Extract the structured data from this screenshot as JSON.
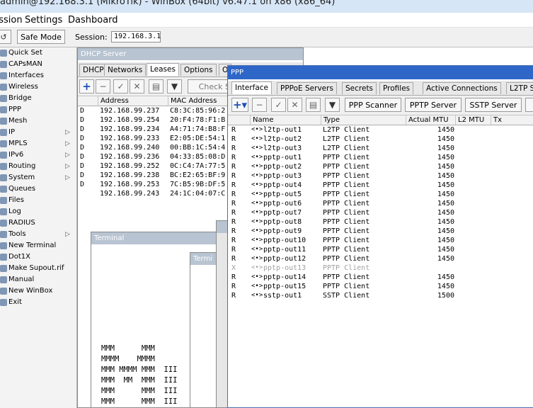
{
  "app": {
    "title": "admin@192.168.3.1 (MikroTik) - WinBox (64bit) v6.47.1 on x86 (x86_64)"
  },
  "menu": [
    "Session",
    "Settings",
    "Dashboard"
  ],
  "toolbar": {
    "safe_mode": "Safe Mode",
    "session_label": "Session:",
    "session_value": "192.168.3.1"
  },
  "sidebar": {
    "items": [
      {
        "label": "Quick Set",
        "arrow": ""
      },
      {
        "label": "CAPsMAN",
        "arrow": ""
      },
      {
        "label": "Interfaces",
        "arrow": ""
      },
      {
        "label": "Wireless",
        "arrow": ""
      },
      {
        "label": "Bridge",
        "arrow": ""
      },
      {
        "label": "PPP",
        "arrow": ""
      },
      {
        "label": "Mesh",
        "arrow": ""
      },
      {
        "label": "IP",
        "arrow": "▷"
      },
      {
        "label": "MPLS",
        "arrow": "▷"
      },
      {
        "label": "IPv6",
        "arrow": "▷"
      },
      {
        "label": "Routing",
        "arrow": "▷"
      },
      {
        "label": "System",
        "arrow": "▷"
      },
      {
        "label": "Queues",
        "arrow": ""
      },
      {
        "label": "Files",
        "arrow": ""
      },
      {
        "label": "Log",
        "arrow": ""
      },
      {
        "label": "RADIUS",
        "arrow": ""
      },
      {
        "label": "Tools",
        "arrow": "▷"
      },
      {
        "label": "New Terminal",
        "arrow": ""
      },
      {
        "label": "Dot1X",
        "arrow": ""
      },
      {
        "label": "Make Supout.rif",
        "arrow": ""
      },
      {
        "label": "Manual",
        "arrow": ""
      },
      {
        "label": "New WinBox",
        "arrow": ""
      },
      {
        "label": "Exit",
        "arrow": ""
      }
    ]
  },
  "dhcp": {
    "title": "DHCP Server",
    "tabs": [
      "DHCP",
      "Networks",
      "Leases",
      "Options",
      "O"
    ],
    "check_status": "Check St",
    "columns": [
      "Address",
      "MAC Address"
    ],
    "rows": [
      {
        "flag": "D",
        "address": "192.168.99.237",
        "mac": "C8:3C:85:96:2"
      },
      {
        "flag": "D",
        "address": "192.168.99.254",
        "mac": "20:F4:78:F1:B"
      },
      {
        "flag": "D",
        "address": "192.168.99.234",
        "mac": "A4:71:74:B8:F"
      },
      {
        "flag": "D",
        "address": "192.168.99.233",
        "mac": "E2:05:DE:54:1"
      },
      {
        "flag": "D",
        "address": "192.168.99.240",
        "mac": "00:BB:1C:54:4"
      },
      {
        "flag": "D",
        "address": "192.168.99.236",
        "mac": "04:33:85:08:D"
      },
      {
        "flag": "D",
        "address": "192.168.99.252",
        "mac": "0C:C4:7A:77:5"
      },
      {
        "flag": "D",
        "address": "192.168.99.238",
        "mac": "BC:E2:65:BF:9"
      },
      {
        "flag": "D",
        "address": "192.168.99.253",
        "mac": "7C:B5:9B:DF:5"
      },
      {
        "flag": "",
        "address": "192.168.99.243",
        "mac": "24:1C:04:07:C"
      }
    ]
  },
  "terminal": {
    "title": "Terminal",
    "title2": "Termi",
    "lines": [
      "MMM      MMM",
      "MMMM    MMMM",
      "MMM MMMM MMM  III   MMM",
      "MMM  MM  MMM  III   MMM",
      "MMM      MMM  III   MMM",
      "MMM      MMM  III   MMM"
    ]
  },
  "ppp": {
    "title": "PPP",
    "tabs": [
      "Interface",
      "PPPoE Servers",
      "Secrets",
      "Profiles",
      "Active Connections",
      "L2TP S"
    ],
    "buttons": {
      "pppoe_scanner": "PPP Scanner",
      "pptp_server": "PPTP Server",
      "sstp_server": "SSTP Server",
      "more": "L"
    },
    "columns": [
      "Name",
      "Type",
      "Actual MTU",
      "L2 MTU",
      "Tx"
    ],
    "rows": [
      {
        "flag": "R",
        "name": "l2tp-out1",
        "type": "L2TP Client",
        "mtu": "1450",
        "disabled": false
      },
      {
        "flag": "R",
        "name": "l2tp-out2",
        "type": "L2TP Client",
        "mtu": "1450",
        "disabled": false
      },
      {
        "flag": "R",
        "name": "l2tp-out3",
        "type": "L2TP Client",
        "mtu": "1450",
        "disabled": false
      },
      {
        "flag": "R",
        "name": "pptp-out1",
        "type": "PPTP Client",
        "mtu": "1450",
        "disabled": false
      },
      {
        "flag": "R",
        "name": "pptp-out2",
        "type": "PPTP Client",
        "mtu": "1450",
        "disabled": false
      },
      {
        "flag": "R",
        "name": "pptp-out3",
        "type": "PPTP Client",
        "mtu": "1450",
        "disabled": false
      },
      {
        "flag": "R",
        "name": "pptp-out4",
        "type": "PPTP Client",
        "mtu": "1450",
        "disabled": false
      },
      {
        "flag": "R",
        "name": "pptp-out5",
        "type": "PPTP Client",
        "mtu": "1450",
        "disabled": false
      },
      {
        "flag": "R",
        "name": "pptp-out6",
        "type": "PPTP Client",
        "mtu": "1450",
        "disabled": false
      },
      {
        "flag": "R",
        "name": "pptp-out7",
        "type": "PPTP Client",
        "mtu": "1450",
        "disabled": false
      },
      {
        "flag": "R",
        "name": "pptp-out8",
        "type": "PPTP Client",
        "mtu": "1450",
        "disabled": false
      },
      {
        "flag": "R",
        "name": "pptp-out9",
        "type": "PPTP Client",
        "mtu": "1450",
        "disabled": false
      },
      {
        "flag": "R",
        "name": "pptp-out10",
        "type": "PPTP Client",
        "mtu": "1450",
        "disabled": false
      },
      {
        "flag": "R",
        "name": "pptp-out11",
        "type": "PPTP Client",
        "mtu": "1450",
        "disabled": false
      },
      {
        "flag": "R",
        "name": "pptp-out12",
        "type": "PPTP Client",
        "mtu": "1450",
        "disabled": false
      },
      {
        "flag": "X",
        "name": "pptp-out13",
        "type": "PPTP Client",
        "mtu": "",
        "disabled": true
      },
      {
        "flag": "R",
        "name": "pptp-out14",
        "type": "PPTP Client",
        "mtu": "1450",
        "disabled": false
      },
      {
        "flag": "R",
        "name": "pptp-out15",
        "type": "PPTP Client",
        "mtu": "1450",
        "disabled": false
      },
      {
        "flag": "R",
        "name": "sstp-out1",
        "type": "SSTP Client",
        "mtu": "1500",
        "disabled": false
      }
    ]
  }
}
